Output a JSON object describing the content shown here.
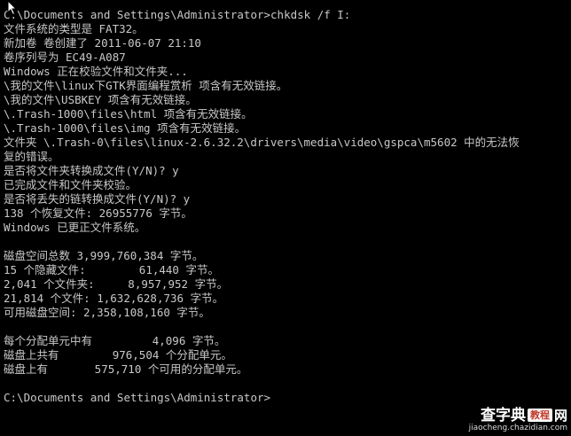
{
  "console": {
    "lines": [
      "C:\\Documents and Settings\\Administrator>chkdsk /f I:",
      "文件系统的类型是 FAT32。",
      "新加卷 卷创建了 2011-06-07 21:10",
      "卷序列号为 EC49-A087",
      "Windows 正在校验文件和文件夹...",
      "\\我的文件\\linux下GTK界面编程赏析 项含有无效链接。",
      "\\我的文件\\USBKEY 项含有无效链接。",
      "\\.Trash-1000\\files\\html 项含有无效链接。",
      "\\.Trash-1000\\files\\img 项含有无效链接。",
      "文件夹 \\.Trash-0\\files\\linux-2.6.32.2\\drivers\\media\\video\\gspca\\m5602 中的无法恢",
      "复的错误。",
      "是否将文件夹转换成文件(Y/N)? y",
      "已完成文件和文件夹校验。",
      "是否将丢失的链转换成文件(Y/N)? y",
      "138 个恢复文件: 26955776 字节。",
      "Windows 已更正文件系统。",
      "",
      "磁盘空间总数 3,999,760,384 字节。",
      "15 个隐藏文件:        61,440 字节。",
      "2,041 个文件夹:     8,957,952 字节。",
      "21,814 个文件: 1,632,628,736 字节。",
      "可用磁盘空间: 2,358,108,160 字节。",
      "",
      "每个分配单元中有         4,096 字节。",
      "磁盘上共有        976,504 个分配单元。",
      "磁盘上有       575,710 个可用的分配单元。",
      "",
      "C:\\Documents and Settings\\Administrator>"
    ]
  },
  "watermark": {
    "title_part1": "查字典",
    "badge": "教程",
    "title_part2": "网",
    "url": "jiaocheng.chazidian.com"
  },
  "icons": {
    "cursor": "mouse-pointer-icon"
  }
}
